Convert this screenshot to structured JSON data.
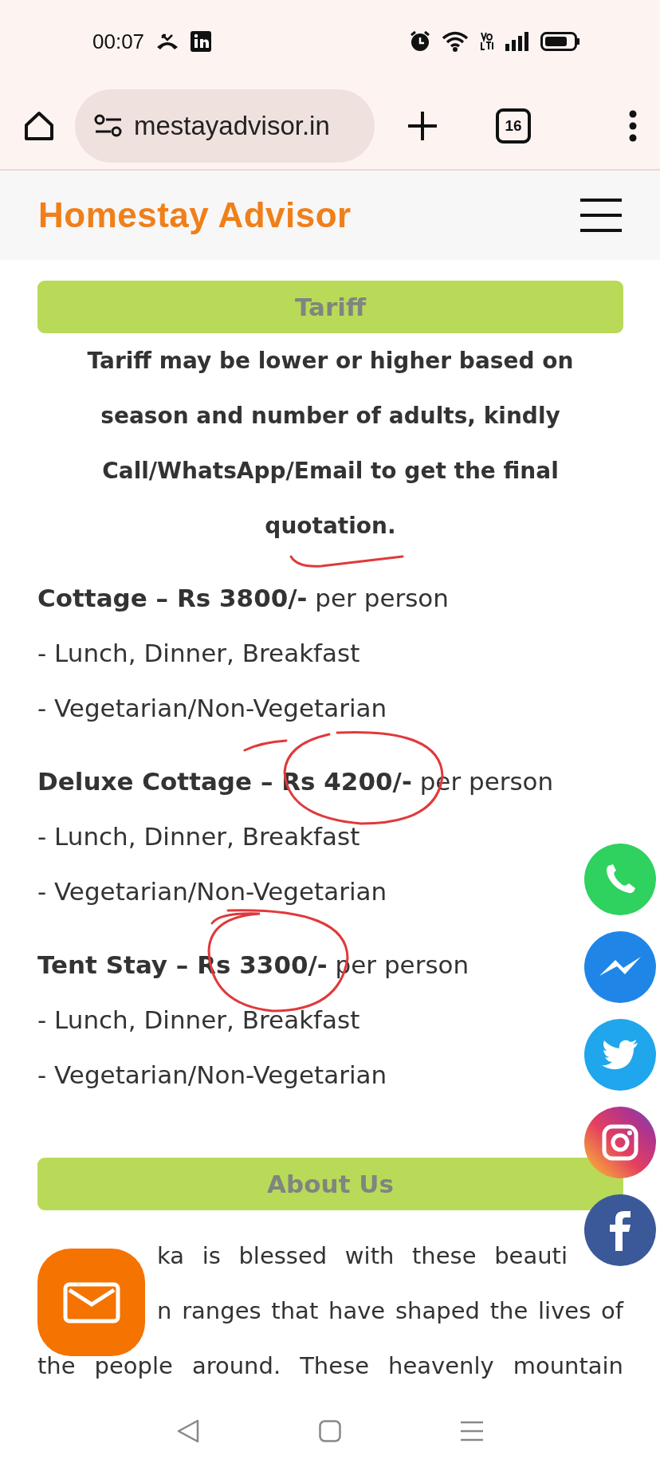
{
  "status_bar": {
    "time": "00:07"
  },
  "browser": {
    "url": "mestayadvisor.in",
    "tab_count": "16"
  },
  "site_header": {
    "title": "Homestay Advisor"
  },
  "tariff": {
    "heading": "Tariff",
    "note": "Tariff may be lower or higher based on season and number of adults, kindly Call/WhatsApp/Email to get the final quotation.",
    "note_underlined": true,
    "rates": [
      {
        "title": "Cottage – Rs 3800/-",
        "unit": "per person",
        "circled": false,
        "items": [
          "- Lunch, Dinner, Breakfast",
          "- Vegetarian/Non-Vegetarian"
        ]
      },
      {
        "title": "Deluxe Cottage – Rs 4200/-",
        "unit": "per person",
        "circled": true,
        "items": [
          "- Lunch, Dinner, Breakfast",
          "- Vegetarian/Non-Vegetarian"
        ]
      },
      {
        "title": "Tent Stay – Rs 3300/-",
        "unit": "per person",
        "circled": true,
        "items": [
          "- Lunch, Dinner, Breakfast",
          "- Vegetarian/Non-Vegetarian"
        ]
      }
    ]
  },
  "about": {
    "heading": "About Us",
    "lines": [
      "ka is blessed with these beauti",
      "n ranges that have shaped the lives of",
      "the people around. These heavenly mountain"
    ]
  }
}
